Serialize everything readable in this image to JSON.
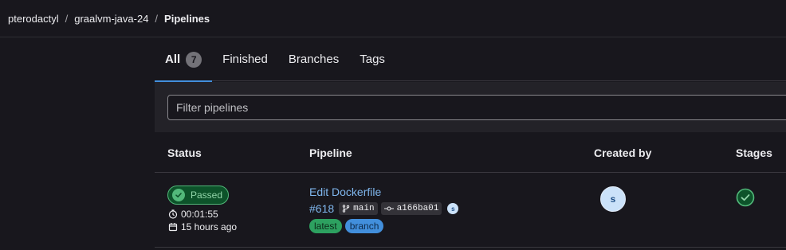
{
  "breadcrumb": {
    "items": [
      "pterodactyl",
      "graalvm-java-24",
      "Pipelines"
    ],
    "separator": "/"
  },
  "tabs": [
    {
      "label": "All",
      "count": "7"
    },
    {
      "label": "Finished"
    },
    {
      "label": "Branches"
    },
    {
      "label": "Tags"
    }
  ],
  "filter": {
    "placeholder": "Filter pipelines"
  },
  "table": {
    "headers": [
      "Status",
      "Pipeline",
      "Created by",
      "Stages"
    ]
  },
  "pipelines": [
    {
      "status": "Passed",
      "duration": "00:01:55",
      "finished": "15 hours ago",
      "title": "Edit Dockerfile",
      "id": "#618",
      "branch": "main",
      "commit": "a166ba01",
      "user_initial": "s",
      "creator_initial": "s",
      "tags": [
        "latest",
        "branch"
      ],
      "stage_status": "passed"
    }
  ],
  "colors": {
    "success": "#52b87a",
    "link": "#7fb6ed",
    "accent": "#428fdc"
  }
}
